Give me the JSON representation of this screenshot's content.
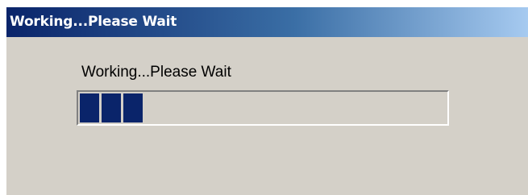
{
  "window": {
    "title": "Working...Please Wait"
  },
  "content": {
    "message": "Working...Please Wait"
  },
  "progress": {
    "filled_blocks": 3,
    "fraction": 0.18
  },
  "colors": {
    "titlebar_start": "#0a246a",
    "titlebar_end": "#a6caf0",
    "dialog_background": "#d4d0c8",
    "progress_block": "#0a246a"
  }
}
